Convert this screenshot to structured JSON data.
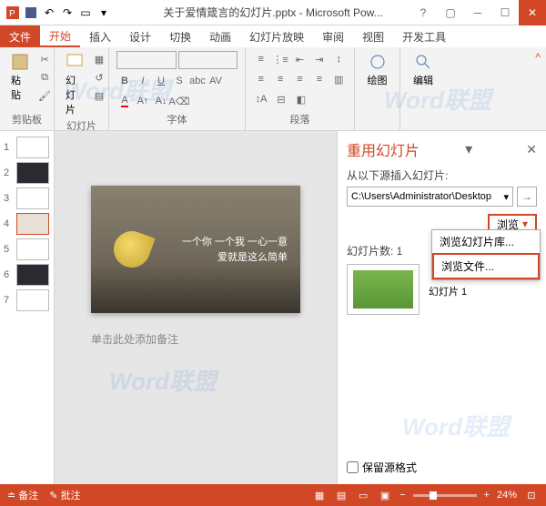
{
  "title": "关于爱情箴言的幻灯片.pptx - Microsoft Pow...",
  "tabs": {
    "file": "文件",
    "home": "开始",
    "insert": "插入",
    "design": "设计",
    "transitions": "切换",
    "animations": "动画",
    "slideshow": "幻灯片放映",
    "review": "审阅",
    "view": "视图",
    "developer": "开发工具"
  },
  "ribbon": {
    "clipboard": {
      "label": "剪贴板",
      "paste": "粘贴"
    },
    "slides": {
      "label": "幻灯片",
      "new": "幻灯片"
    },
    "font": {
      "label": "字体"
    },
    "paragraph": {
      "label": "段落"
    },
    "drawing": {
      "label": "绘图"
    },
    "editing": {
      "label": "编辑"
    }
  },
  "slide": {
    "line1": "一个你 一个我 一心一意",
    "line2": "爱就是这么简单"
  },
  "notes_placeholder": "单击此处添加备注",
  "taskpane": {
    "title": "重用幻灯片",
    "from_label": "从以下源插入幻灯片:",
    "path": "C:\\Users\\Administrator\\Desktop",
    "browse": "浏览",
    "count_label": "幻灯片数: 1",
    "slide_label": "幻灯片 1",
    "dd_library": "浏览幻灯片库...",
    "dd_file": "浏览文件...",
    "keep_format": "保留源格式"
  },
  "statusbar": {
    "notes": "备注",
    "comments": "批注",
    "zoom": "24%"
  },
  "thumbs": [
    1,
    2,
    3,
    4,
    5,
    6,
    7
  ],
  "watermark": "Word联盟"
}
